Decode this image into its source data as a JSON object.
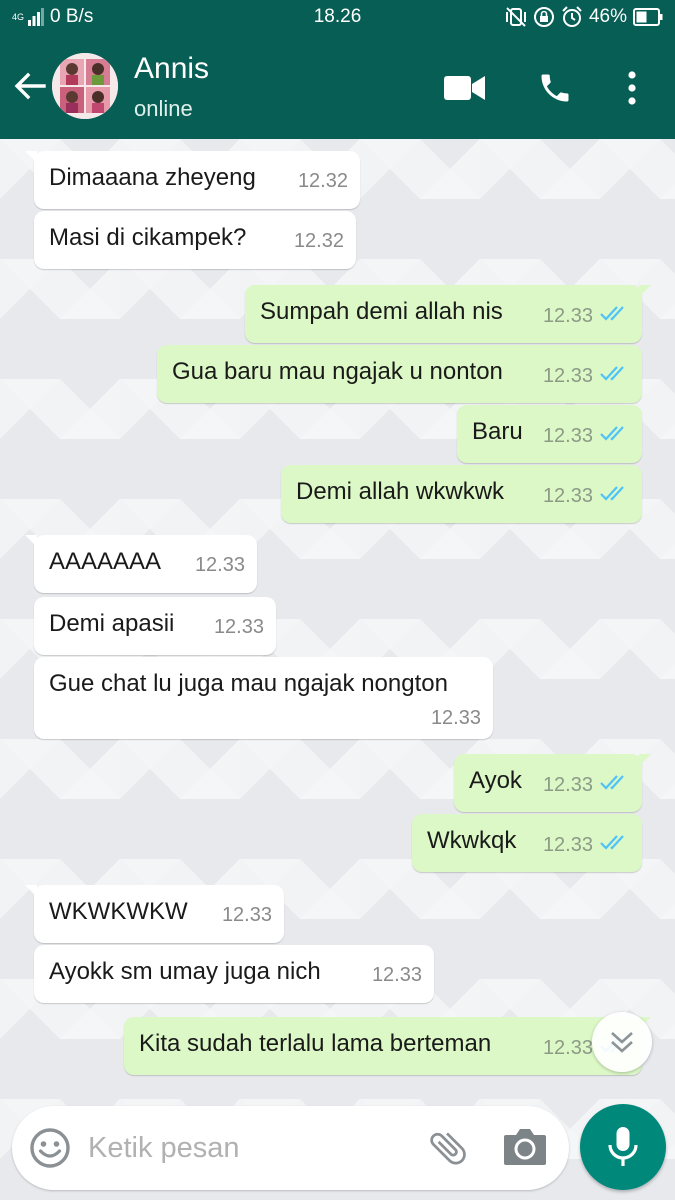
{
  "status_bar": {
    "network": "4G",
    "data_speed": "0 B/s",
    "time": "18.26",
    "battery": "46%"
  },
  "header": {
    "contact_name": "Annis",
    "contact_status": "online",
    "icons": [
      "back-arrow-icon",
      "video-call-icon",
      "phone-icon",
      "more-vert-icon"
    ]
  },
  "messages": [
    {
      "dir": "in",
      "text": "Dimaaana zheyeng",
      "time": "12.32"
    },
    {
      "dir": "in",
      "text": "Masi di cikampek?",
      "time": "12.32"
    },
    {
      "dir": "out",
      "text": "Sumpah demi allah nis",
      "time": "12.33",
      "status": "read"
    },
    {
      "dir": "out",
      "text": "Gua baru mau ngajak u nonton",
      "time": "12.33",
      "status": "read"
    },
    {
      "dir": "out",
      "text": "Baru",
      "time": "12.33",
      "status": "read"
    },
    {
      "dir": "out",
      "text": "Demi allah wkwkwk",
      "time": "12.33",
      "status": "read"
    },
    {
      "dir": "in",
      "text": "AAAAAAA",
      "time": "12.33"
    },
    {
      "dir": "in",
      "text": "Demi apasii",
      "time": "12.33"
    },
    {
      "dir": "in",
      "text": "Gue chat lu juga mau ngajak nongton",
      "time": "12.33"
    },
    {
      "dir": "out",
      "text": "Ayok",
      "time": "12.33",
      "status": "read"
    },
    {
      "dir": "out",
      "text": "Wkwkqk",
      "time": "12.33",
      "status": "read"
    },
    {
      "dir": "in",
      "text": "WKWKWKW",
      "time": "12.33"
    },
    {
      "dir": "in",
      "text": "Ayokk sm umay juga nich",
      "time": "12.33"
    },
    {
      "dir": "out",
      "text": "Kita sudah terlalu lama berteman",
      "time": "12.33",
      "status": "read"
    }
  ],
  "input": {
    "placeholder": "Ketik pesan",
    "value": ""
  },
  "colors": {
    "header": "#075e54",
    "outgoing_bubble": "#dcf8c6",
    "incoming_bubble": "#ffffff",
    "read_ticks": "#4fc3f7",
    "fab": "#00897b"
  }
}
